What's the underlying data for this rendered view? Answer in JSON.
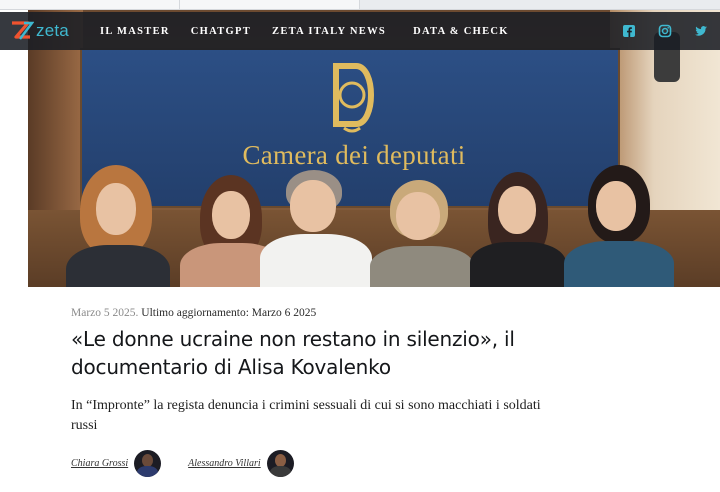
{
  "header": {
    "logo_text": "zeta",
    "nav": [
      "IL MASTER",
      "CHATGPT",
      "ZETA ITALY NEWS",
      "DATA & CHECK"
    ],
    "social_icons": [
      "facebook-icon",
      "instagram-icon",
      "twitter-icon"
    ]
  },
  "hero": {
    "sign_text": "Camera dei deputati"
  },
  "article": {
    "date": "Marzo 5 2025",
    "updated": "Ultimo aggiornamento: Marzo 6 2025",
    "title": "«Le donne ucraine non restano in silenzio», il documentario di Alisa Kovalenko",
    "subtitle": "In “Impronte” la regista denuncia i crimini sessuali di cui si sono macchiati i soldati russi",
    "authors": [
      "Chiara Grossi",
      "Alessandro Villari"
    ]
  },
  "colors": {
    "brand": "#3fb8cf",
    "nav_bg": "#1a1e24",
    "panel_blue": "#2c4f85",
    "gold": "#e0bb5e"
  }
}
